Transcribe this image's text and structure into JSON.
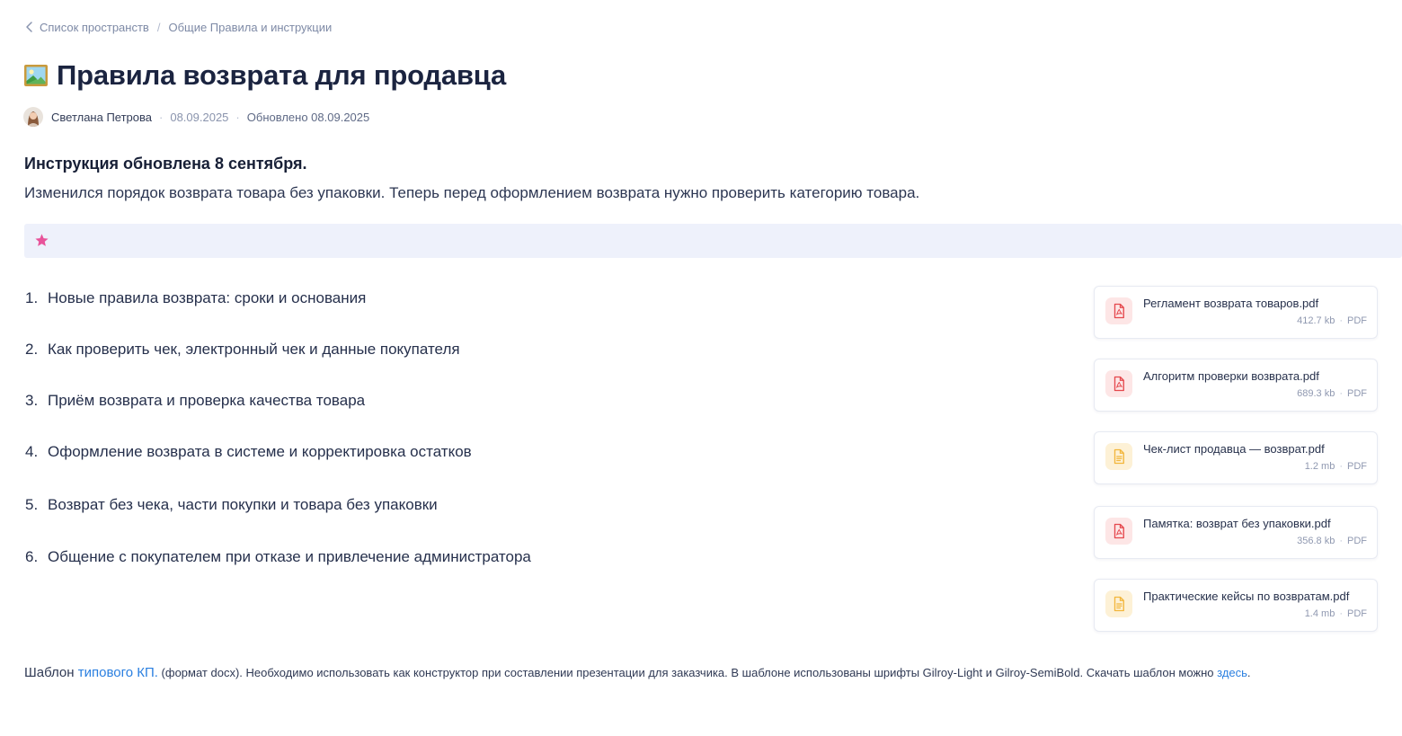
{
  "breadcrumb": {
    "back_label": "Список пространств",
    "separator": "/",
    "current": "Общие Правила и инструкции"
  },
  "page": {
    "title": "Правила  возврата для продавца",
    "title_icon": "framed-picture-icon"
  },
  "meta": {
    "author": "Светлана Петрова",
    "created": "08.09.2025",
    "updated": "Обновлено 08.09.2025"
  },
  "notice": {
    "title": "Инструкция обновлена 8 сентября.",
    "text": "Изменился порядок возврата товара без упаковки. Теперь перед оформлением возврата нужно проверить категорию товара."
  },
  "callout": {
    "icon": "star-icon",
    "background": "#eef1fb",
    "icon_color": "#e8539a"
  },
  "toc": [
    {
      "num": "1.",
      "label": "Новые правила возврата: сроки и основания"
    },
    {
      "num": "2.",
      "label": "Как проверить чек, электронный чек и данные покупателя"
    },
    {
      "num": "3.",
      "label": "Приём возврата и проверка качества товара"
    },
    {
      "num": "4.",
      "label": "Оформление возврата в системе и корректировка остатков"
    },
    {
      "num": "5.",
      "label": "Возврат без чека, части покупки и товара без упаковки"
    },
    {
      "num": "6.",
      "label": "Общение с покупателем при отказе и привлечение администратора"
    }
  ],
  "files": [
    {
      "name": "Регламент возврата товаров.pdf",
      "size": "412.7 kb",
      "type": "PDF",
      "icon": "pdf-file-icon",
      "icon_color": "#e5484d"
    },
    {
      "name": "Алгоритм проверки возврата.pdf",
      "size": "689.3 kb",
      "type": "PDF",
      "icon": "pdf-file-icon",
      "icon_color": "#e5484d"
    },
    {
      "name": "Чек-лист продавца — возврат.pdf",
      "size": "1.2 mb",
      "type": "PDF",
      "icon": "document-icon",
      "icon_color": "#f2b63c"
    },
    {
      "name": "Памятка: возврат без упаковки.pdf",
      "size": "356.8 kb",
      "type": "PDF",
      "icon": "pdf-file-icon",
      "icon_color": "#e5484d"
    },
    {
      "name": "Практические кейсы по возвратам.pdf",
      "size": "1.4 mb",
      "type": "PDF",
      "icon": "document-icon",
      "icon_color": "#f2b63c"
    }
  ],
  "footer": {
    "prefix": "Шаблон ",
    "link1": "типового КП.",
    "middle": " (формат docx). Необходимо использовать как конструктор при составлении презентации для заказчика. В шаблоне использованы шрифты Gilroy-Light и Gilroy-SemiBold. Скачать шаблон можно ",
    "link2": "здесь",
    "suffix": ".",
    "link_color": "#2a7fe0"
  },
  "colors": {
    "text": "#1f2a44",
    "muted": "#7e8aa6",
    "accent": "#2a7fe0",
    "pdf_red": "#e5484d",
    "doc_yellow": "#f2b63c"
  }
}
